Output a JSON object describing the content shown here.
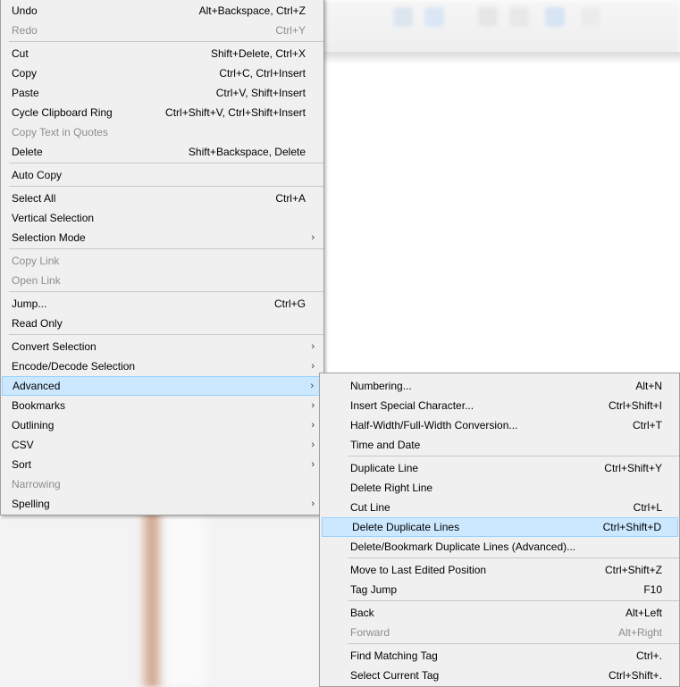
{
  "colors": {
    "menu_bg": "#f0f0f0",
    "highlight_bg": "#cce8ff",
    "highlight_border": "#99d1ff",
    "disabled_text": "#8d8d8d"
  },
  "main_menu": {
    "items": [
      {
        "label": "Undo",
        "shortcut": "Alt+Backspace, Ctrl+Z"
      },
      {
        "label": "Redo",
        "shortcut": "Ctrl+Y",
        "disabled": true
      },
      {
        "sep": true
      },
      {
        "label": "Cut",
        "shortcut": "Shift+Delete, Ctrl+X"
      },
      {
        "label": "Copy",
        "shortcut": "Ctrl+C, Ctrl+Insert"
      },
      {
        "label": "Paste",
        "shortcut": "Ctrl+V, Shift+Insert"
      },
      {
        "label": "Cycle Clipboard Ring",
        "shortcut": "Ctrl+Shift+V, Ctrl+Shift+Insert"
      },
      {
        "label": "Copy Text in Quotes",
        "disabled": true
      },
      {
        "label": "Delete",
        "shortcut": "Shift+Backspace, Delete"
      },
      {
        "sep": true
      },
      {
        "label": "Auto Copy"
      },
      {
        "sep": true
      },
      {
        "label": "Select All",
        "shortcut": "Ctrl+A"
      },
      {
        "label": "Vertical Selection"
      },
      {
        "label": "Selection Mode",
        "submenu": true
      },
      {
        "sep": true
      },
      {
        "label": "Copy Link",
        "disabled": true
      },
      {
        "label": "Open Link",
        "disabled": true
      },
      {
        "sep": true
      },
      {
        "label": "Jump...",
        "shortcut": "Ctrl+G"
      },
      {
        "label": "Read Only"
      },
      {
        "sep": true
      },
      {
        "label": "Convert Selection",
        "submenu": true
      },
      {
        "label": "Encode/Decode Selection",
        "submenu": true
      },
      {
        "label": "Advanced",
        "submenu": true,
        "highlight": true
      },
      {
        "label": "Bookmarks",
        "submenu": true
      },
      {
        "label": "Outlining",
        "submenu": true
      },
      {
        "label": "CSV",
        "submenu": true
      },
      {
        "label": "Sort",
        "submenu": true
      },
      {
        "label": "Narrowing",
        "disabled": true
      },
      {
        "label": "Spelling",
        "submenu": true
      }
    ]
  },
  "advanced_submenu": {
    "items": [
      {
        "label": "Numbering...",
        "shortcut": "Alt+N"
      },
      {
        "label": "Insert Special Character...",
        "shortcut": "Ctrl+Shift+I"
      },
      {
        "label": "Half-Width/Full-Width Conversion...",
        "shortcut": "Ctrl+T"
      },
      {
        "label": "Time and Date"
      },
      {
        "sep": true
      },
      {
        "label": "Duplicate Line",
        "shortcut": "Ctrl+Shift+Y"
      },
      {
        "label": "Delete Right Line"
      },
      {
        "label": "Cut Line",
        "shortcut": "Ctrl+L"
      },
      {
        "label": "Delete Duplicate Lines",
        "shortcut": "Ctrl+Shift+D",
        "highlight": true
      },
      {
        "label": "Delete/Bookmark Duplicate Lines (Advanced)..."
      },
      {
        "sep": true
      },
      {
        "label": "Move to Last Edited Position",
        "shortcut": "Ctrl+Shift+Z"
      },
      {
        "label": "Tag Jump",
        "shortcut": "F10"
      },
      {
        "sep": true
      },
      {
        "label": "Back",
        "shortcut": "Alt+Left"
      },
      {
        "label": "Forward",
        "shortcut": "Alt+Right",
        "disabled": true
      },
      {
        "sep": true
      },
      {
        "label": "Find Matching Tag",
        "shortcut": "Ctrl+."
      },
      {
        "label": "Select Current Tag",
        "shortcut": "Ctrl+Shift+."
      }
    ]
  },
  "icons": {
    "submenu_arrow": "chevron-right-icon",
    "submenu_arrow_glyph": "›"
  }
}
